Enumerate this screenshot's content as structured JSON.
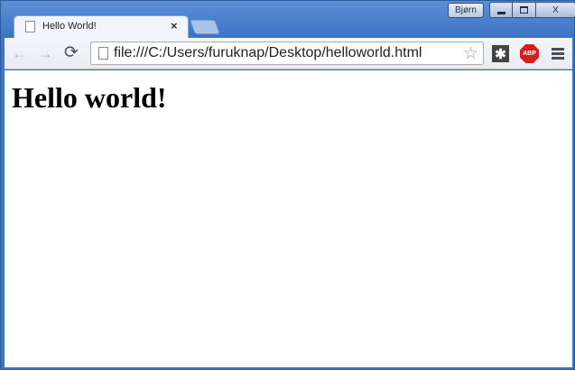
{
  "window": {
    "user_button": "Bjørn",
    "close_glyph": "X"
  },
  "tab": {
    "title": "Hello World!",
    "close_glyph": "×"
  },
  "toolbar": {
    "back_glyph": "←",
    "forward_glyph": "→",
    "reload_glyph": "⟳",
    "url": "file:///C:/Users/furuknap/Desktop/helloworld.html",
    "star_glyph": "☆",
    "extension_glyph": "✱",
    "adblock_label": "ABP"
  },
  "page": {
    "heading": "Hello world!"
  },
  "icons": [
    "page-icon",
    "back-arrow-icon",
    "forward-arrow-icon",
    "reload-icon",
    "star-icon",
    "extension-icon",
    "adblock-icon",
    "menu-icon"
  ],
  "colors": {
    "frame": "#3d74c4",
    "adblock": "#d31f1f"
  }
}
